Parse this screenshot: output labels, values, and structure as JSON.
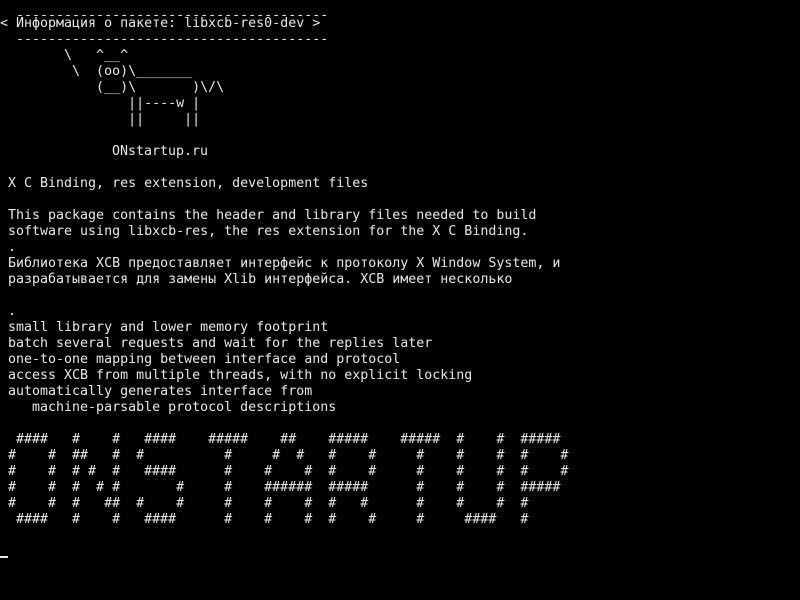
{
  "terminal": {
    "foreground": "#e8e8e8",
    "background": "#000000",
    "cowsay": {
      "border_top": " ---------------------------------------",
      "message": "< Информация о пакете: libxcb-res0-dev >",
      "border_bottom": " ---------------------------------------",
      "cow": [
        "       \\   ^__^",
        "        \\  (oo)\\_______",
        "           (__)\\       )\\/\\",
        "               ||----w |",
        "               ||     ||"
      ]
    },
    "site": "ONstartup.ru",
    "summary": "X C Binding, res extension, development files",
    "description": [
      "This package contains the header and library files needed to build",
      "software using libxcb-res, the res extension for the X C Binding.",
      ".",
      "Библиотека XCB предоставляет интерфейс к протоколу X Window System, и",
      "разрабатывается для замены Xlib интерфейса. XCB имеет несколько"
    ],
    "features_dot": ".",
    "features": [
      "small library and lower memory footprint",
      "batch several requests and wait for the replies later",
      "one-to-one mapping between interface and protocol",
      "access XCB from multiple threads, with no explicit locking",
      "automatically generates interface from",
      "   machine-parsable protocol descriptions"
    ],
    "banner": [
      " ####   #    #   ####    #####    ##    #####    #####  #    #  #####",
      "#    #  ##   #  #          #     #  #   #    #     #    #    #  #    #",
      "#    #  # #  #   ####      #    #    #  #    #     #    #    #  #    #",
      "#    #  #  # #       #     #    ######  #####      #    #    #  #####",
      "#    #  #   ##  #    #     #    #    #  #   #      #    #    #  #",
      " ####   #    #   ####      #    #    #  #    #     #     ####   #"
    ]
  }
}
